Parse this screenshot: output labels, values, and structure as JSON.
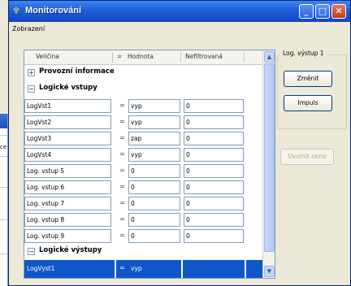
{
  "background_window": {
    "fragment": "ce"
  },
  "window": {
    "title": "Monitorování",
    "buttons": {
      "minimize": "_",
      "maximize": "□",
      "close": "✕"
    }
  },
  "menu": {
    "items": [
      "Zobrazení"
    ]
  },
  "grid": {
    "columns": [
      "Veličina",
      "=",
      "Hodnota",
      "Nefiltrovaná"
    ],
    "sections": [
      {
        "title": "Provozní informace",
        "toggle": "+"
      },
      {
        "title": "Logické vstupy",
        "toggle": "−"
      },
      {
        "title": "Logické výstupy",
        "toggle": "−"
      }
    ],
    "rows": [
      {
        "name": "LogVst1",
        "eq": "=",
        "value": "vyp",
        "unfiltered": "0"
      },
      {
        "name": "LogVst2",
        "eq": "=",
        "value": "vyp",
        "unfiltered": "0"
      },
      {
        "name": "LogVst3",
        "eq": "=",
        "value": "zap",
        "unfiltered": "0"
      },
      {
        "name": "LogVst4",
        "eq": "=",
        "value": "vyp",
        "unfiltered": "0"
      },
      {
        "name": "Log. vstup 5",
        "eq": "=",
        "value": "0",
        "unfiltered": "0"
      },
      {
        "name": "Log. vstup 6",
        "eq": "=",
        "value": "0",
        "unfiltered": "0"
      },
      {
        "name": "Log. vstup 7",
        "eq": "=",
        "value": "0",
        "unfiltered": "0"
      },
      {
        "name": "Log. vstup 8",
        "eq": "=",
        "value": "0",
        "unfiltered": "0"
      },
      {
        "name": "Log. vstup 9",
        "eq": "=",
        "value": "0",
        "unfiltered": "0"
      }
    ],
    "output_rows": [
      {
        "name": "LogVyst1",
        "eq": "=",
        "value": "vyp",
        "unfiltered": ""
      }
    ]
  },
  "side_panel": {
    "group_label": "Log. výstup 1",
    "change_button": "Změnit",
    "pulse_button": "Impuls",
    "release_button": "Uvolnit okno"
  },
  "colors": {
    "title_bar": "#1e5fd8",
    "selection": "#0f57c8",
    "window_bg": "#ece9d8"
  }
}
